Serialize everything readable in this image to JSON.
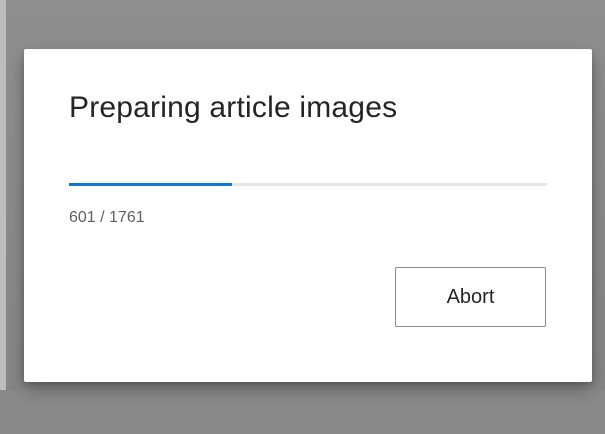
{
  "dialog": {
    "title": "Preparing article images",
    "progress": {
      "current": 601,
      "total": 1761,
      "text": "601 / 1761"
    },
    "abort_label": "Abort"
  },
  "colors": {
    "accent": "#1278d0",
    "track": "#e6e6e6",
    "backdrop": "#8a8a8a"
  }
}
